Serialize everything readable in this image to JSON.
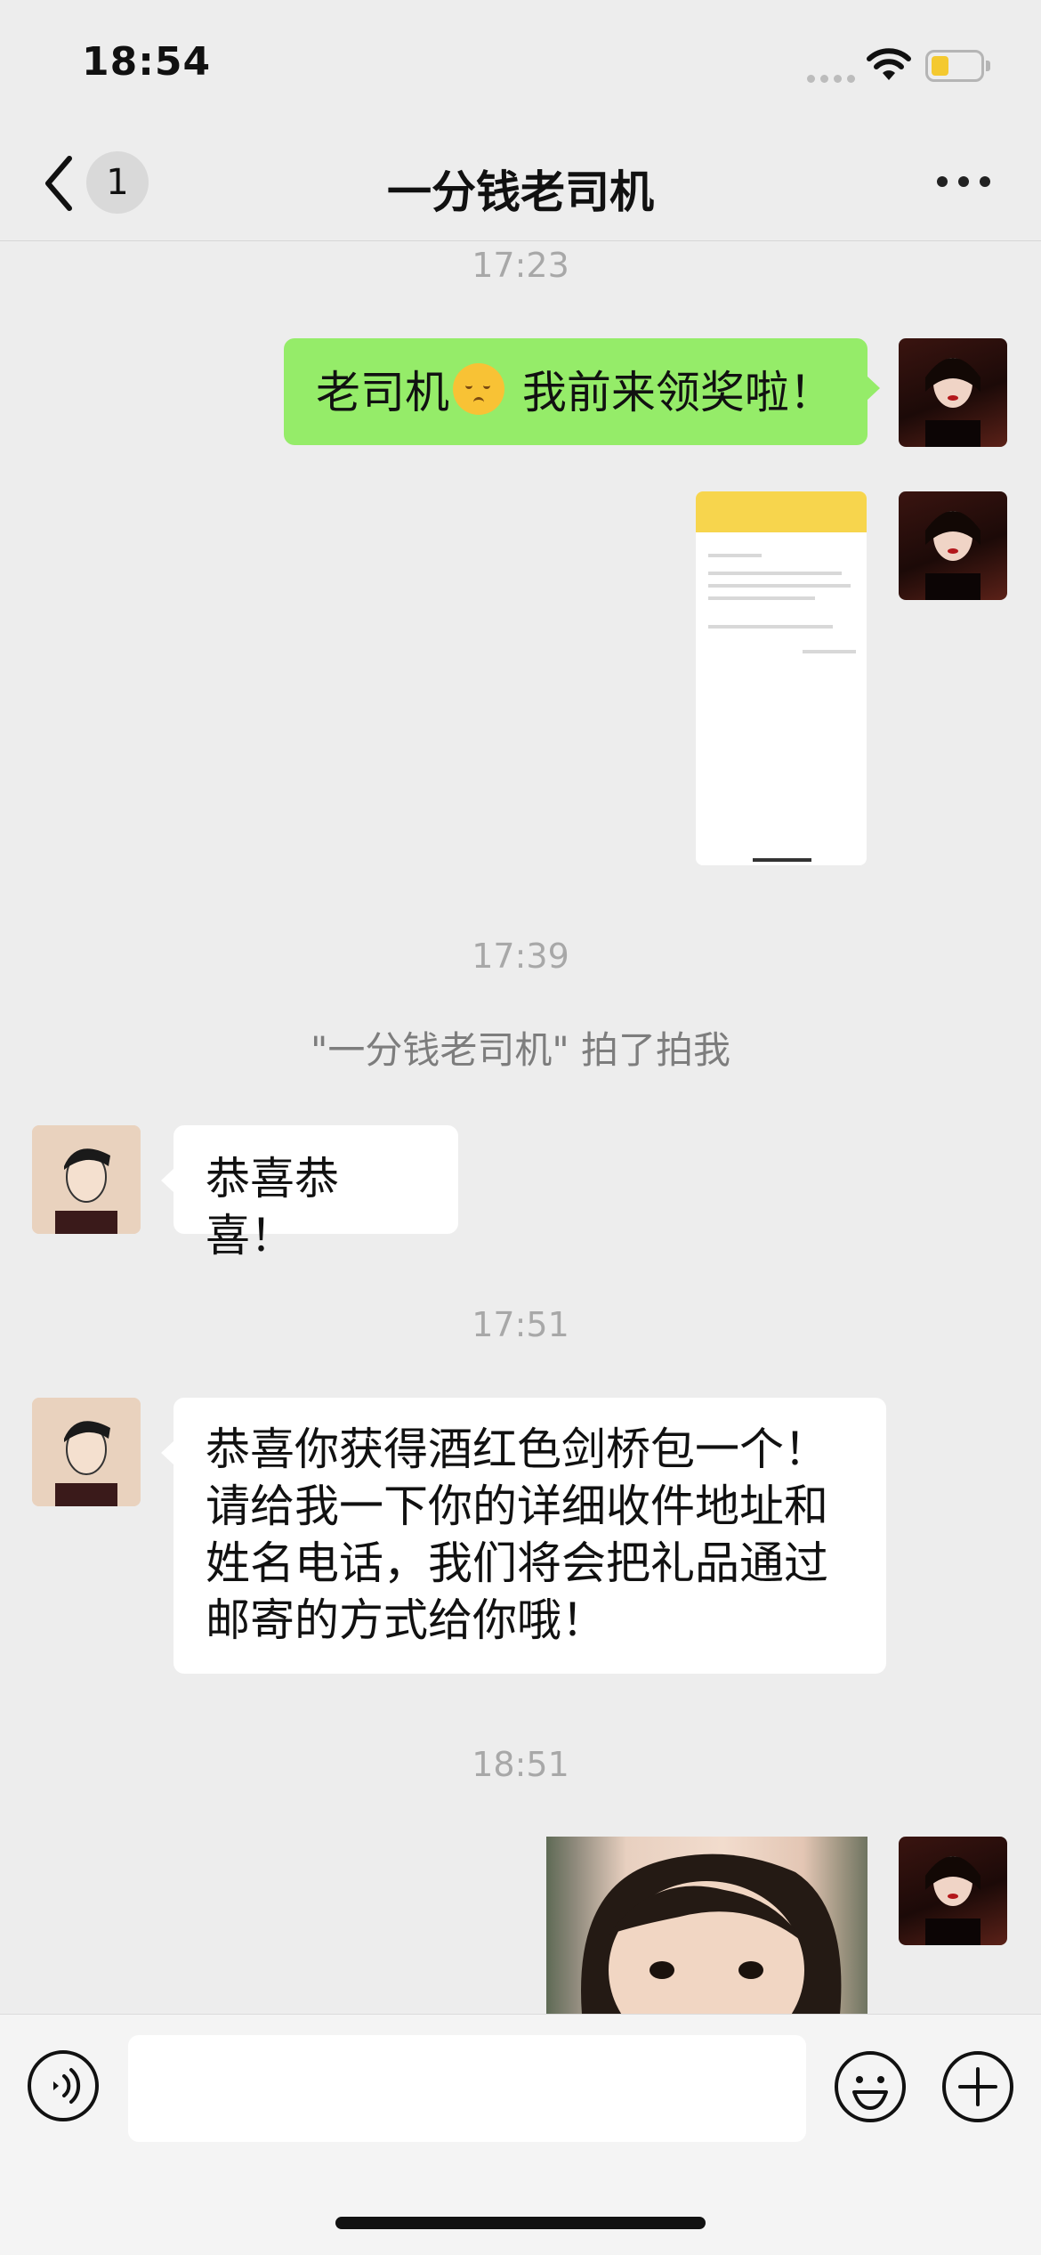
{
  "status_bar": {
    "time": "18:54",
    "battery_level": 0.35,
    "battery_color": "#f4c930"
  },
  "nav": {
    "back_icon": "chevron-left-icon",
    "unread_count": "1",
    "title": "一分钱老司机",
    "more_icon": "more-horizontal-icon"
  },
  "messages": {
    "time_1": "17:23",
    "msg_1_text": "老司机",
    "msg_1_emoji": "🥺",
    "msg_1_text_after": " 我前来领奖啦！",
    "msg_2_image": "screenshot-image",
    "time_2": "17:39",
    "system_tip": "\"一分钱老司机\" 拍了拍我",
    "msg_3_text": "恭喜恭喜！",
    "time_3": "17:51",
    "msg_4_lines": [
      "恭喜你获得酒红色剑桥包一个！",
      "请给我一下你的详细收件地址和",
      "姓名电话，我们将会把礼品通过",
      "邮寄的方式给你哦！"
    ],
    "time_4": "18:51",
    "msg_5_image": "photo-image"
  },
  "input_bar": {
    "voice_icon": "voice-icon",
    "input_value": "",
    "emoji_icon": "emoji-icon",
    "plus_icon": "plus-circle-icon"
  },
  "colors": {
    "background": "#ededed",
    "sent_bubble": "#95ec69",
    "received_bubble": "#ffffff",
    "timestamp": "#a8a8a8"
  }
}
